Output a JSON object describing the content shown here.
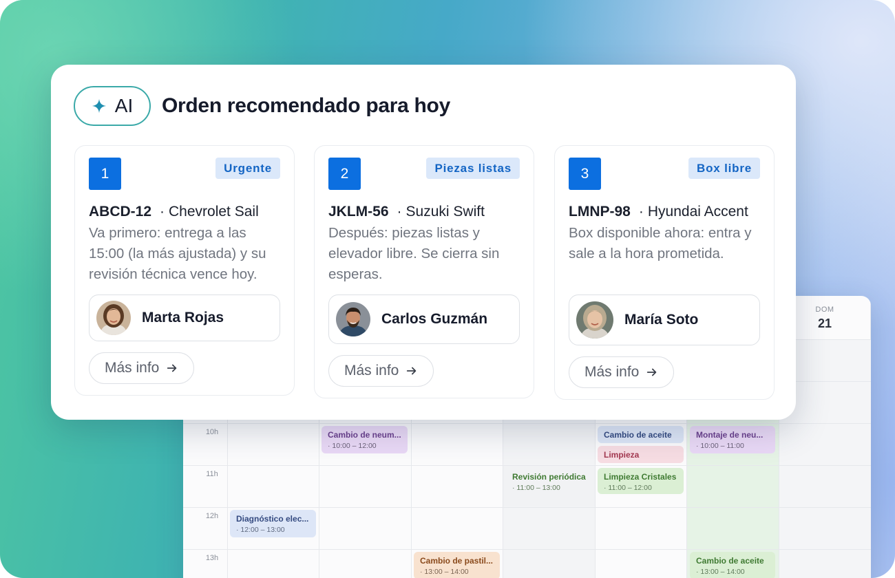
{
  "ai_panel": {
    "badge_label": "AI",
    "title": "Orden recomendado para hoy",
    "recommendations": [
      {
        "rank": "1",
        "tag": "Urgente",
        "plate": "ABCD-12",
        "separator": "·",
        "car": "Chevrolet Sail",
        "description": "Va primero: entrega a las 15:00 (la más ajustada) y su revisión técnica vence hoy.",
        "person": "Marta Rojas",
        "more_label": "Más info"
      },
      {
        "rank": "2",
        "tag": "Piezas listas",
        "plate": "JKLM-56",
        "separator": "·",
        "car": "Suzuki Swift",
        "description": "Después: piezas listas y elevador libre. Se cierra sin esperas.",
        "person": "Carlos Guzmán",
        "more_label": "Más info"
      },
      {
        "rank": "3",
        "tag": "Box libre",
        "plate": "LMNP-98",
        "separator": "·",
        "car": "Hyundai Accent",
        "description": "Box disponible ahora: entra y sale a la hora prometida.",
        "person": "María Soto",
        "more_label": "Más info"
      }
    ]
  },
  "calendar": {
    "visible_day": {
      "dow": "DOM",
      "num": "21"
    },
    "hours": [
      "10h",
      "11h",
      "12h",
      "13h"
    ],
    "events": [
      {
        "title": "Cambio de neum...",
        "time": "· 10:00 – 12:00"
      },
      {
        "title": "Cambio de aceite",
        "time": ""
      },
      {
        "title": "Limpieza",
        "time": ""
      },
      {
        "title": "Montaje de neu...",
        "time": "· 10:00 – 11:00"
      },
      {
        "title": "Revisión periódica",
        "time": "· 11:00 – 13:00"
      },
      {
        "title": "Limpieza Cristales",
        "time": "· 11:00 – 12:00"
      },
      {
        "title": "Diagnóstico elec...",
        "time": "· 12:00 – 13:00"
      },
      {
        "title": "Cambio de pastil...",
        "time": "· 13:00 – 14:00"
      },
      {
        "title": "Cambio de aceite",
        "time": "· 13:00 – 14:00"
      }
    ]
  },
  "colors": {
    "accent": "#0c6fe0",
    "tag_bg": "#dbe8fa",
    "ai_border": "#3aa9a8"
  }
}
